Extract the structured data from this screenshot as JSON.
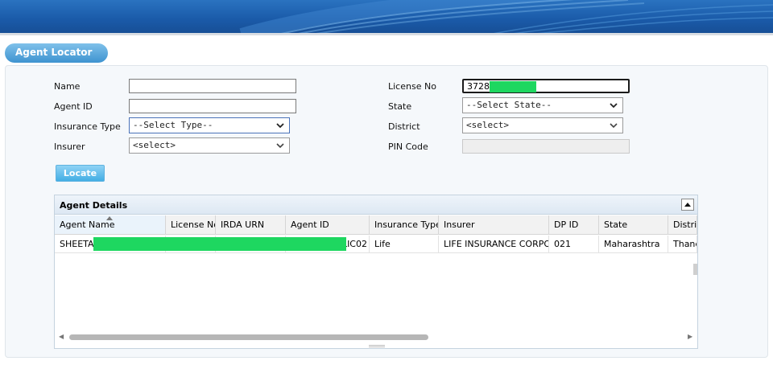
{
  "page": {
    "title": "Agent Locator"
  },
  "form": {
    "name_label": "Name",
    "agent_id_label": "Agent ID",
    "insurance_type_label": "Insurance Type",
    "insurer_label": "Insurer",
    "license_no_label": "License No",
    "state_label": "State",
    "district_label": "District",
    "pin_code_label": "PIN Code",
    "name_value": "",
    "agent_id_value": "",
    "license_no_value": "3728",
    "insurance_type_selected": "--Select Type--",
    "insurer_selected": "<select>",
    "state_selected": "--Select State--",
    "district_selected": "<select>",
    "pin_code_value": "",
    "locate_button": "Locate"
  },
  "grid": {
    "title": "Agent Details",
    "columns": [
      "Agent Name",
      "License No",
      "IRDA URN",
      "Agent ID",
      "Insurance Type",
      "Insurer",
      "DP ID",
      "State",
      "District"
    ],
    "rows": [
      {
        "agent_name": "SHEETA",
        "license_no": "",
        "irda_urn": "",
        "agent_id": "LIC02",
        "insurance_type": "Life",
        "insurer": "LIFE INSURANCE CORPO",
        "dp_id": "021",
        "state": "Maharashtra",
        "district": "Thane"
      }
    ]
  },
  "colors": {
    "banner": "#1a5aa8",
    "accent": "#43aee4",
    "redaction": "#1ed760"
  },
  "icons": [
    "chevron-down-icon",
    "collapse-up-icon",
    "sort-up-icon",
    "scroll-left-icon",
    "scroll-right-icon"
  ]
}
